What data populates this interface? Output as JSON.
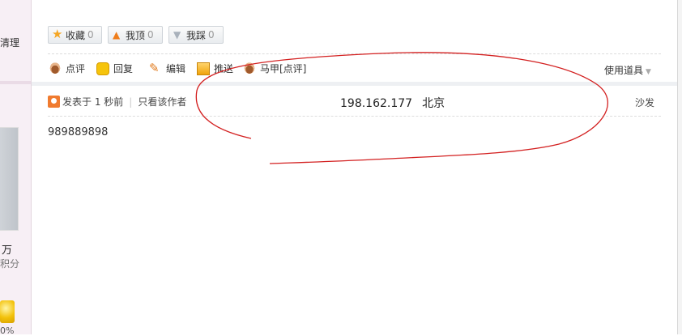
{
  "sidebar": {
    "clean_label": "清理",
    "stat_value": "万",
    "stat_unit": "积分",
    "percent": "0%"
  },
  "actions": {
    "favorite": {
      "label": "收藏",
      "count": "0",
      "icon": "star-icon"
    },
    "upvote": {
      "label": "我顶",
      "count": "0",
      "icon": "thumb-up-icon"
    },
    "downvote": {
      "label": "我踩",
      "count": "0",
      "icon": "thumb-down-icon"
    }
  },
  "tools": [
    {
      "label": "点评",
      "icon": "comment-icon"
    },
    {
      "label": "回复",
      "icon": "reply-icon"
    },
    {
      "label": "编辑",
      "icon": "edit-icon"
    },
    {
      "label": "推送",
      "icon": "push-icon"
    },
    {
      "label": "马甲[点评]",
      "icon": "mask-comment-icon"
    }
  ],
  "props_label": "使用道具",
  "post": {
    "posted_label": "发表于 1 秒前",
    "author_only": "只看该作者",
    "ip": "198.162.177",
    "location": "北京",
    "floor": "沙发",
    "content": "989889898"
  },
  "colors": {
    "annotation": "#d32020",
    "accent": "#f07b2f"
  }
}
